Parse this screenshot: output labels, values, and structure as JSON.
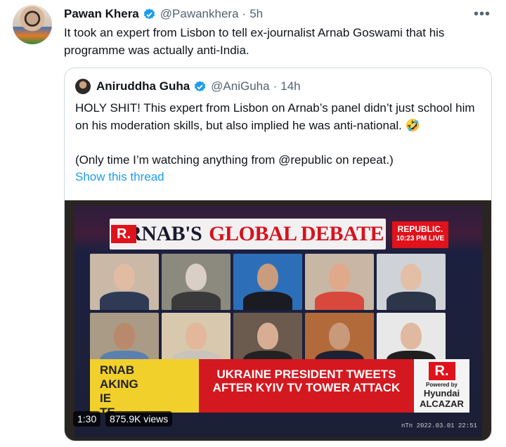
{
  "tweet": {
    "author_name": "Pawan Khera",
    "handle": "@Pawankhera",
    "separator": "·",
    "time": "5h",
    "more_icon": "more-dots-icon",
    "text": "It took an expert from Lisbon to tell ex-journalist Arnab Goswami that his programme was actually anti-India."
  },
  "quoted": {
    "author_name": "Aniruddha Guha",
    "handle": "@AniGuha",
    "separator": "·",
    "time": "14h",
    "para1": "HOLY SHIT! This expert from Lisbon on Arnab’s panel didn’t just school him on his moderation skills, but also implied he was anti-national. 🤣",
    "para2": "(Only time I’m watching anything from @republic on repeat.)",
    "show_thread": "Show this thread"
  },
  "video": {
    "title_part1": "ARNAB'S",
    "title_part2": "GLOBAL DEBATE",
    "channel_logo": "R.",
    "channel_name": "REPUBLIC.",
    "channel_time": "10:23 PM",
    "channel_live": "LIVE",
    "ticker_left": "RNAB\nAKING\nIE\nTE",
    "ticker_headline": "UKRAINE PRESIDENT TWEETS AFTER KYIV TV TOWER ATTACK",
    "sponsor_logo": "R.",
    "sponsor_powered": "Powered by",
    "sponsor_name": "Hyundai ALCAZAR",
    "duration": "1:30",
    "views": "875.9K views",
    "stamp": "nTn 2022.03.01 22:51"
  },
  "colors": {
    "link": "#1d9bf0",
    "verified": "#1d9bf0",
    "text": "#0f1419",
    "muted": "#536471"
  }
}
